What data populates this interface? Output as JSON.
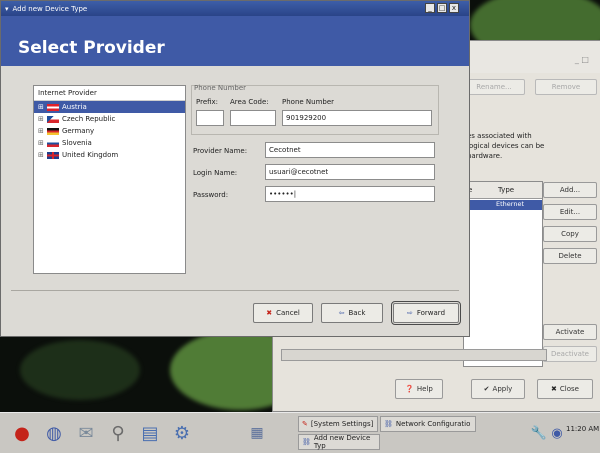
{
  "background_window": {
    "buttons": {
      "rename": "Rename...",
      "remove": "Remove",
      "add": "Add...",
      "edit": "Edit...",
      "copy": "Copy",
      "delete": "Delete",
      "activate": "Activate",
      "deactivate": "Deactivate",
      "help": "Help",
      "apply": "Apply",
      "close": "Close"
    },
    "info_text": [
      "es associated with",
      "logical devices can be",
      "hardware."
    ],
    "list": {
      "col_type": "Type",
      "row_type": "Ethernet"
    }
  },
  "dialog": {
    "window_title": "Add new Device Type",
    "header_title": "Select Provider",
    "tree": {
      "header": "Internet Provider",
      "items": [
        {
          "label": "Austria",
          "selected": true
        },
        {
          "label": "Czech Republic",
          "selected": false
        },
        {
          "label": "Germany",
          "selected": false
        },
        {
          "label": "Slovenia",
          "selected": false
        },
        {
          "label": "United Kingdom",
          "selected": false
        }
      ]
    },
    "phone": {
      "group_label": "Phone Number",
      "prefix_label": "Prefix:",
      "area_code_label": "Area Code:",
      "phone_number_label": "Phone Number",
      "prefix_value": "",
      "area_code_value": "",
      "phone_number_value": "901929200"
    },
    "provider_name_label": "Provider Name:",
    "provider_name_value": "Cecotnet",
    "login_name_label": "Login Name:",
    "login_name_value": "usuari@cecotnet",
    "password_label": "Password:",
    "password_value": "••••••|",
    "buttons": {
      "cancel": "Cancel",
      "back": "Back",
      "forward": "Forward"
    }
  },
  "taskbar": {
    "tasks": [
      {
        "label": "[System Settings]"
      },
      {
        "label": "Network Configuratio"
      },
      {
        "label": "Add new Device Typ"
      }
    ],
    "clock": "11:20 AM"
  },
  "colors": {
    "titlebar": "#2f4a90",
    "accent": "#3f5aa6",
    "dialog_bg": "#dcdad5"
  }
}
